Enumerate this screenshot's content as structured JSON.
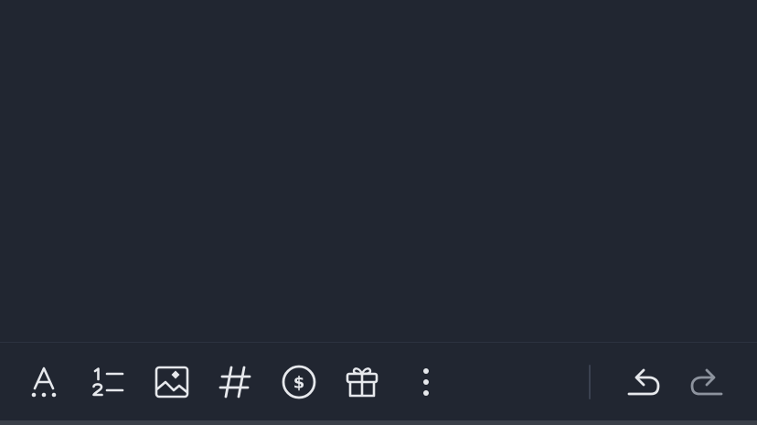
{
  "colors": {
    "background": "#212631",
    "icon": "#e6e8ec",
    "icon_disabled": "#8d939e",
    "separator": "#3a4150"
  },
  "toolbar": {
    "tools": [
      {
        "icon": "text-format-icon",
        "enabled": true
      },
      {
        "icon": "numbered-list-icon",
        "enabled": true
      },
      {
        "icon": "image-icon",
        "enabled": true
      },
      {
        "icon": "hashtag-icon",
        "enabled": true
      },
      {
        "icon": "dollar-coin-icon",
        "enabled": true
      },
      {
        "icon": "gift-icon",
        "enabled": true
      },
      {
        "icon": "more-vertical-icon",
        "enabled": true
      }
    ],
    "history": [
      {
        "icon": "undo-icon",
        "enabled": true
      },
      {
        "icon": "redo-icon",
        "enabled": false
      }
    ]
  }
}
